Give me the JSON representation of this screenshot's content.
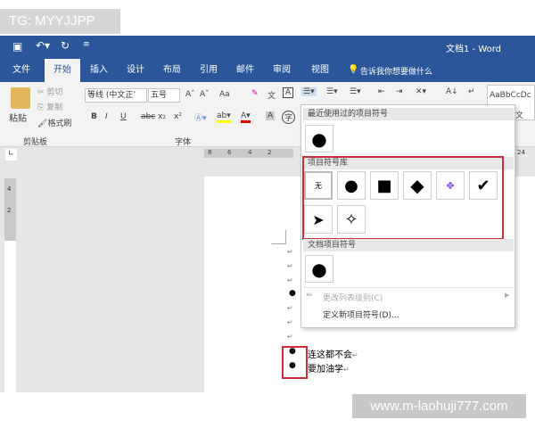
{
  "watermark_top": "TG: MYYJJPP",
  "watermark_bottom": "www.m-laohuji777.com",
  "titlebar": {
    "title": "文档1 - Word",
    "qat": [
      "save-icon",
      "undo-icon",
      "redo-icon",
      "customize-icon"
    ]
  },
  "tabs": [
    "文件",
    "开始",
    "插入",
    "设计",
    "布局",
    "引用",
    "邮件",
    "审阅",
    "视图"
  ],
  "tell_me": "告诉我你想要做什么",
  "clipboard": {
    "paste": "粘贴",
    "cut": "剪切",
    "copy": "复制",
    "format_painter": "格式刷",
    "group": "剪贴板"
  },
  "font": {
    "name": "等线 (中文正’",
    "size": "五号",
    "group": "字体",
    "bold": "B",
    "italic": "I",
    "underline": "U",
    "strike": "abc",
    "sub": "x₂",
    "sup": "x²",
    "grow": "Aˆ",
    "shrink": "Aˇ",
    "case": "Aa"
  },
  "styles": {
    "preview": "AaBbCcDc",
    "label": "文"
  },
  "ruler": {
    "h": [
      "8",
      "6",
      "4",
      "2"
    ],
    "right": "24",
    "v": [
      "4",
      "2"
    ]
  },
  "dropdown": {
    "recent_header": "最近使用过的项目符号",
    "library_header": "项目符号库",
    "none": "无",
    "doc_header": "文档项目符号",
    "change_level": "更改列表级别(C)",
    "define_new": "定义新项目符号(D)..."
  },
  "document": {
    "lines": [
      "连这都不会",
      "要加油学"
    ],
    "return_mark": "↵",
    "bullet": "●"
  },
  "colors": {
    "brand": "#2b579a",
    "highlight": "#c9303a"
  }
}
